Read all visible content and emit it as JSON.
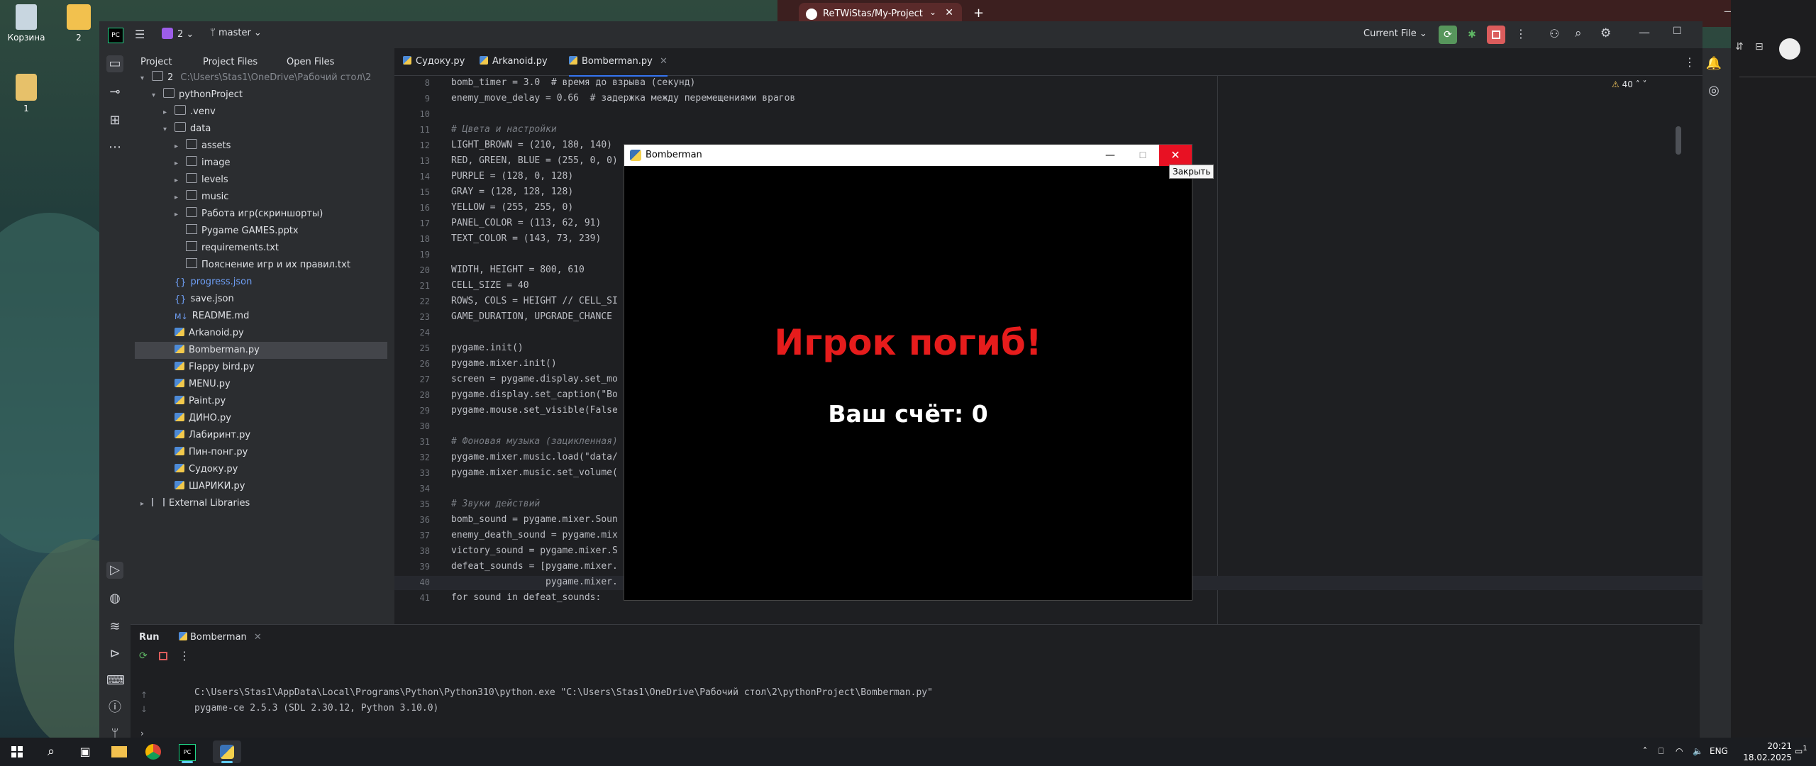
{
  "desktop": {
    "icons": [
      {
        "label": "Корзина"
      },
      {
        "label": "2"
      },
      {
        "label": "1"
      }
    ]
  },
  "browser": {
    "tab_title": "ReTWiStas/My-Project",
    "tab_close": "✕",
    "new_tab": "+"
  },
  "ide": {
    "project_badge": "2",
    "branch": "master",
    "run_config": "Current File",
    "project_view_tabs": [
      "Project",
      "Project Files",
      "Open Files"
    ],
    "tree": [
      {
        "label": "2",
        "path": "C:\\Users\\Stas1\\OneDrive\\Рабочий стол\\2"
      },
      {
        "label": "pythonProject"
      },
      {
        "label": ".venv"
      },
      {
        "label": "data"
      },
      {
        "label": "assets"
      },
      {
        "label": "image"
      },
      {
        "label": "levels"
      },
      {
        "label": "music"
      },
      {
        "label": "Работа игр(скриншорты)"
      },
      {
        "label": "Pygame GAMES.pptx"
      },
      {
        "label": "requirements.txt"
      },
      {
        "label": "Пояснение игр и их правил.txt"
      },
      {
        "label": "progress.json"
      },
      {
        "label": "save.json"
      },
      {
        "label": "README.md"
      },
      {
        "label": "Arkanoid.py"
      },
      {
        "label": "Bomberman.py"
      },
      {
        "label": "Flappy bird.py"
      },
      {
        "label": "MENU.py"
      },
      {
        "label": "Paint.py"
      },
      {
        "label": "ДИНО.py"
      },
      {
        "label": "Лабиринт.py"
      },
      {
        "label": "Пин-понг.py"
      },
      {
        "label": "Судоку.py"
      },
      {
        "label": "ШАРИКИ.py"
      },
      {
        "label": "External Libraries"
      }
    ],
    "editor_tabs": [
      "Судоку.py",
      "Arkanoid.py",
      "Bomberman.py"
    ],
    "warnings_count": "40",
    "code_lines": [
      {
        "n": "8",
        "text": "bomb_timer = 3.0  # время до взрыва (секунд)"
      },
      {
        "n": "9",
        "text": "enemy_move_delay = 0.66  # задержка между перемещениями врагов"
      },
      {
        "n": "10",
        "text": ""
      },
      {
        "n": "11",
        "text": "# Цвета и настройки"
      },
      {
        "n": "12",
        "text": "LIGHT_BROWN = (210, 180, 140)"
      },
      {
        "n": "13",
        "text": "RED, GREEN, BLUE = (255, 0, 0)"
      },
      {
        "n": "14",
        "text": "PURPLE = (128, 0, 128)"
      },
      {
        "n": "15",
        "text": "GRAY = (128, 128, 128)"
      },
      {
        "n": "16",
        "text": "YELLOW = (255, 255, 0)"
      },
      {
        "n": "17",
        "text": "PANEL_COLOR = (113, 62, 91)"
      },
      {
        "n": "18",
        "text": "TEXT_COLOR = (143, 73, 239)"
      },
      {
        "n": "19",
        "text": ""
      },
      {
        "n": "20",
        "text": "WIDTH, HEIGHT = 800, 610"
      },
      {
        "n": "21",
        "text": "CELL_SIZE = 40"
      },
      {
        "n": "22",
        "text": "ROWS, COLS = HEIGHT // CELL_SI"
      },
      {
        "n": "23",
        "text": "GAME_DURATION, UPGRADE_CHANCE"
      },
      {
        "n": "24",
        "text": ""
      },
      {
        "n": "25",
        "text": "pygame.init()"
      },
      {
        "n": "26",
        "text": "pygame.mixer.init()"
      },
      {
        "n": "27",
        "text": "screen = pygame.display.set_mo"
      },
      {
        "n": "28",
        "text": "pygame.display.set_caption(\"Bo"
      },
      {
        "n": "29",
        "text": "pygame.mouse.set_visible(False"
      },
      {
        "n": "30",
        "text": ""
      },
      {
        "n": "31",
        "text": "# Фоновая музыка (зацикленная)"
      },
      {
        "n": "32",
        "text": "pygame.mixer.music.load(\"data/"
      },
      {
        "n": "33",
        "text": "pygame.mixer.music.set_volume("
      },
      {
        "n": "34",
        "text": ""
      },
      {
        "n": "35",
        "text": "# Звуки действий"
      },
      {
        "n": "36",
        "text": "bomb_sound = pygame.mixer.Soun"
      },
      {
        "n": "37",
        "text": "enemy_death_sound = pygame.mix"
      },
      {
        "n": "38",
        "text": "victory_sound = pygame.mixer.S"
      },
      {
        "n": "39",
        "text": "defeat_sounds = [pygame.mixer."
      },
      {
        "n": "40",
        "text": "                 pygame.mixer."
      },
      {
        "n": "41",
        "text": "for sound in defeat_sounds:"
      }
    ],
    "run": {
      "label": "Run",
      "tab": "Bomberman",
      "output": [
        "C:\\Users\\Stas1\\AppData\\Local\\Programs\\Python\\Python310\\python.exe \"C:\\Users\\Stas1\\OneDrive\\Рабочий стол\\2\\pythonProject\\Bomberman.py\"",
        "pygame-ce 2.5.3 (SDL 2.30.12, Python 3.10.0)"
      ]
    }
  },
  "pygame_window": {
    "title": "Bomberman",
    "close_tooltip": "Закрыть",
    "game_over_text": "Игрок погиб!",
    "score_text": "Ваш счёт: 0"
  },
  "taskbar": {
    "lang": "ENG",
    "time": "20:21",
    "date": "18.02.2025",
    "notifications": "1"
  },
  "colors": {
    "accent": "#3574f0",
    "game_over": "#e61c1c",
    "close_red": "#e81123"
  }
}
